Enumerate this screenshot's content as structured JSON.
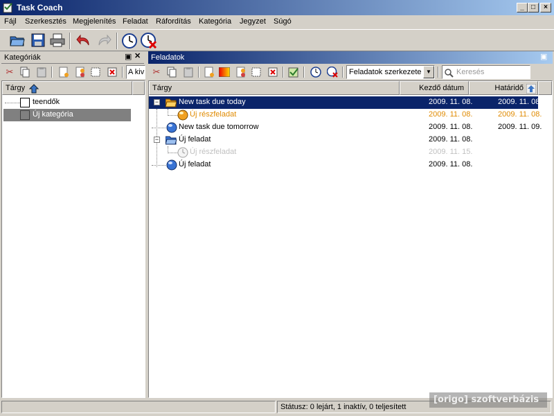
{
  "window": {
    "title": "Task Coach"
  },
  "menu": {
    "items": [
      {
        "label": "Fájl"
      },
      {
        "label": "Szerkesztés"
      },
      {
        "label": "Megjelenítés"
      },
      {
        "label": "Feladat"
      },
      {
        "label": "Ráfordítás"
      },
      {
        "label": "Kategória"
      },
      {
        "label": "Jegyzet"
      },
      {
        "label": "Súgó"
      }
    ]
  },
  "categories_pane": {
    "title": "Kategóriák",
    "filter_value": "A kiv",
    "column_header": "Tárgy",
    "items": [
      {
        "label": "teendők",
        "selected": false
      },
      {
        "label": "Új kategória",
        "selected": true
      }
    ]
  },
  "tasks_pane": {
    "title": "Feladatok",
    "view_select": "Feladatok szerkezete",
    "search_placeholder": "Keresés",
    "columns": {
      "subject": "Tárgy",
      "start": "Kezdő dátum",
      "due": "Határidő"
    },
    "rows": [
      {
        "subject": "New task due today",
        "start": "2009. 11. 08.",
        "due": "2009. 11. 08.",
        "state": "selected",
        "color": "#ffffff",
        "icon": "folder-open-icon"
      },
      {
        "subject": "Új részfeladat",
        "start": "2009. 11. 08.",
        "due": "2009. 11. 08.",
        "state": "due-today",
        "color": "#e08a00",
        "icon": "orange-ball-icon"
      },
      {
        "subject": "New task due tomorrow",
        "start": "2009. 11. 08.",
        "due": "2009. 11. 09.",
        "state": "normal",
        "color": "#000000",
        "icon": "blue-ball-icon"
      },
      {
        "subject": "Új feladat",
        "start": "2009. 11. 08.",
        "due": "",
        "state": "normal",
        "color": "#000000",
        "icon": "folder-icon"
      },
      {
        "subject": "Új részfeladat",
        "start": "2009. 11. 15.",
        "due": "",
        "state": "inactive",
        "color": "#c0c0c0",
        "icon": "clock-icon"
      },
      {
        "subject": "Új feladat",
        "start": "2009. 11. 08.",
        "due": "",
        "state": "normal",
        "color": "#000000",
        "icon": "blue-ball-icon"
      }
    ]
  },
  "statusbar": {
    "text": "Státusz: 0 lejárt, 1 inaktív, 0 teljesített"
  },
  "watermark": {
    "text": "[origo] szoftverbázis"
  },
  "colors": {
    "title_gradient_start": "#0a246a",
    "title_gradient_end": "#a6caf0",
    "face": "#d4d0c8"
  }
}
